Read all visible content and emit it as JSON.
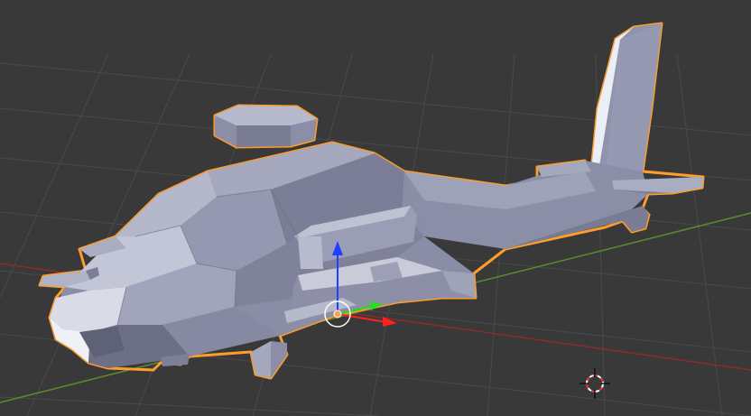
{
  "app": "3D Viewport",
  "viewport": {
    "background": "#393939",
    "grid_color": "#4a4a4a",
    "axis_x_color": "#8c2b2b",
    "axis_y_color": "#5c8c2b"
  },
  "object": {
    "name": "helicopter-mesh",
    "selected": true,
    "selection_outline": "#ff9c2a",
    "base_color": "#8f93ac"
  },
  "gizmo": {
    "x_color": "#ff2020",
    "y_color": "#20e020",
    "z_color": "#2040ff",
    "pivot_color": "#f2a35c"
  },
  "cursor": {
    "icon": "3d-cursor-icon",
    "ring_colors": [
      "#ffffff",
      "#ff3030"
    ]
  }
}
